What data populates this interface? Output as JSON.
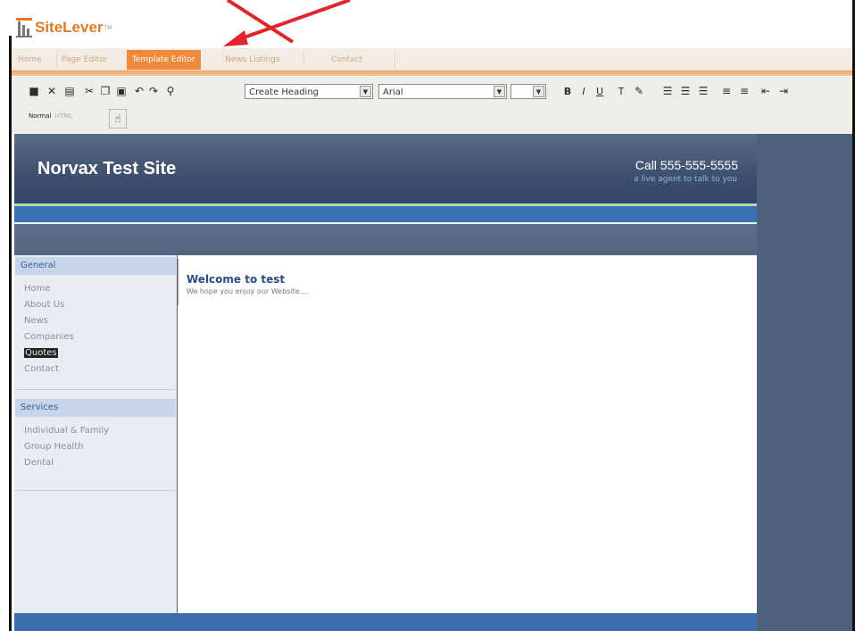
{
  "app": {
    "logo_text": "SiteLever",
    "logo_tm": "TM",
    "tabs": [
      {
        "label": "Home",
        "active": false
      },
      {
        "label": "Page Editor",
        "active": false
      },
      {
        "label": "Template Editor",
        "active": true
      },
      {
        "label": "News Listings",
        "active": false
      },
      {
        "label": "Contact",
        "active": false
      }
    ]
  },
  "toolbar": {
    "format_select": "Create Heading",
    "font_select": "Arial",
    "size_select": "",
    "view_normal": "Normal",
    "view_html": "HTML"
  },
  "site": {
    "title": "Norvax Test Site",
    "phone": "Call 555-555-5555",
    "tagline": "a live agent to talk to you",
    "sidebar_sections": [
      {
        "heading": "General",
        "links": [
          "Home",
          "About Us",
          "News",
          "Companies",
          "Quotes",
          "Contact"
        ],
        "selected": "Quotes"
      },
      {
        "heading": "Services",
        "links": [
          "Individual & Family",
          "Group Health",
          "Dental"
        ]
      }
    ],
    "welcome_title": "Welcome to test",
    "welcome_text": "We hope you enjoy our Website...."
  },
  "colors": {
    "accent_orange": "#f08a3b",
    "annotation_arrow": "#e0262a",
    "site_blue": "#3a73b4",
    "canvas_slate": "#51617c"
  }
}
